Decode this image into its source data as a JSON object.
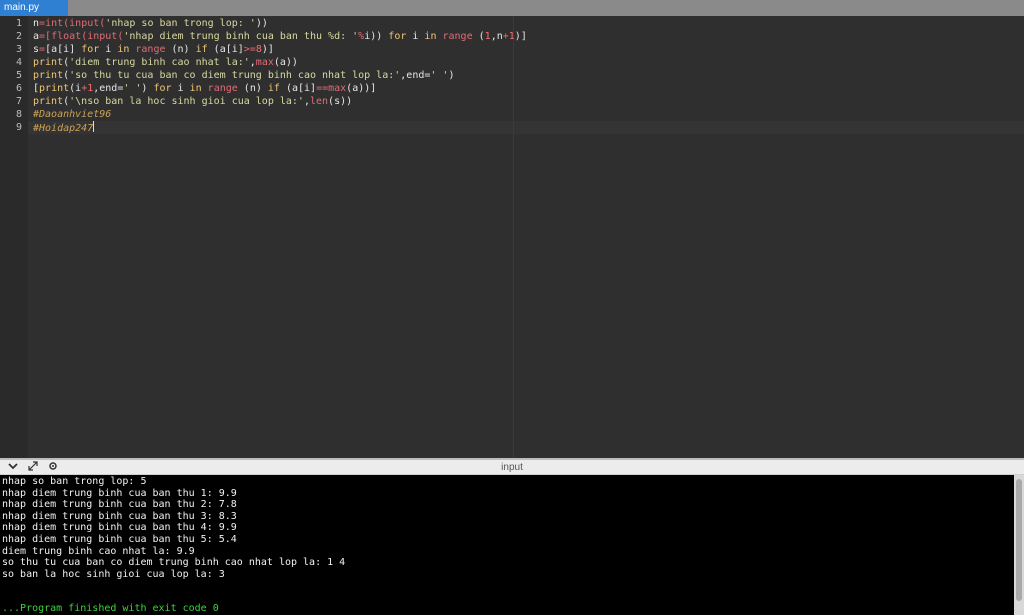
{
  "tab": {
    "label": "main.py"
  },
  "editor": {
    "line_numbers": [
      "1",
      "2",
      "3",
      "4",
      "5",
      "6",
      "7",
      "8",
      "9"
    ],
    "line1": {
      "a": "n",
      "b": "=",
      "c": "int",
      "d": "(",
      "e": "input",
      "f": "(",
      "g": "'nhap so ban trong lop: '",
      "h": "))"
    },
    "line2": {
      "a": "a",
      "b": "=[",
      "c": "float",
      "d": "(",
      "e": "input",
      "f": "(",
      "g": "'nhap diem trung binh cua ban thu %d: '",
      "h": "%",
      "i": "i)) ",
      "j": "for",
      "k": " i ",
      "l": "in",
      "m": " ",
      "n": "range",
      "o": " (",
      "p": "1",
      "q": ",n",
      "r": "+",
      "s": "1",
      "t": ")]"
    },
    "line3": {
      "a": "s",
      "b": "=",
      "c": "[a[i] ",
      "d": "for",
      "e": " i ",
      "f": "in",
      "g": " ",
      "h": "range",
      "i": " (n) ",
      "j": "if",
      "k": " (a[i]",
      "l": ">=",
      "m": "8",
      "n": ")]"
    },
    "line4": {
      "a": "print",
      "b": "(",
      "c": "'diem trung binh cao nhat la:'",
      "d": ",",
      "e": "max",
      "f": "(a))"
    },
    "line5": {
      "a": "print",
      "b": "(",
      "c": "'so thu tu cua ban co diem trung binh cao nhat lop la:'",
      "d": ",end=",
      "e": "' '",
      "f": ")"
    },
    "line6": {
      "a": "[",
      "b": "print",
      "c": "(i",
      "d": "+",
      "e": "1",
      "f": ",end=",
      "g": "' '",
      "h": ") ",
      "i": "for",
      "j": " i ",
      "k": "in",
      "l": " ",
      "m": "range",
      "n": " (n) ",
      "o": "if",
      "p": " (a[i]",
      "q": "==",
      "r": "max",
      "s": "(a))]"
    },
    "line7": {
      "a": "print",
      "b": "(",
      "c": "'\\nso ban la hoc sinh gioi cua lop la:'",
      "d": ",",
      "e": "len",
      "f": "(s))"
    },
    "line8": "#Daoanhviet96",
    "line9": "#Hoidap247"
  },
  "panel": {
    "title": "input"
  },
  "console": {
    "lines": [
      "nhap so ban trong lop: 5",
      "nhap diem trung binh cua ban thu 1: 9.9",
      "nhap diem trung binh cua ban thu 2: 7.8",
      "nhap diem trung binh cua ban thu 3: 8.3",
      "nhap diem trung binh cua ban thu 4: 9.9",
      "nhap diem trung binh cua ban thu 5: 5.4",
      "diem trung binh cao nhat la: 9.9",
      "so thu tu cua ban co diem trung binh cao nhat lop la: 1 4",
      "so ban la hoc sinh gioi cua lop la: 3",
      "",
      "",
      "...Program finished with exit code 0"
    ]
  },
  "icons": {
    "collapse": "chevron-down-icon",
    "expand": "expand-icon",
    "settings": "gear-icon"
  }
}
